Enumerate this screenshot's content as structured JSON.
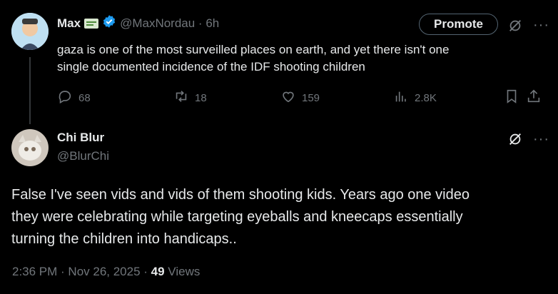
{
  "original_tweet": {
    "display_name": "Max",
    "handle_time": "@MaxNordau · 6h",
    "text_line1": "gaza is one of the most surveilled places on earth, and yet there isn't one",
    "text_line2": "single documented incidence of the IDF shooting children",
    "promote_label": "Promote",
    "replies": "68",
    "reposts": "18",
    "likes": "159",
    "views": "2.8K"
  },
  "reply_tweet": {
    "display_name": "Chi Blur",
    "handle": "@BlurChi",
    "text_line1": "False I've seen vids and vids of them shooting kids. Years ago one video",
    "text_line2": "they were celebrating while targeting eyeballs and kneecaps essentially",
    "text_line3": "turning the children into handicaps..",
    "time_date": "2:36 PM · Nov 26, 2025 · ",
    "views_count": "49",
    "views_label": " Views"
  },
  "colors": {
    "background": "#000000",
    "text": "#e7e9ea",
    "muted": "#71767b",
    "verified": "#1d9bf0"
  },
  "icons": [
    "grok-icon",
    "more-icon",
    "reply-icon",
    "repost-icon",
    "like-icon",
    "analytics-icon",
    "bookmark-icon",
    "share-icon",
    "verified-badge-icon",
    "card-emoji-icon"
  ]
}
